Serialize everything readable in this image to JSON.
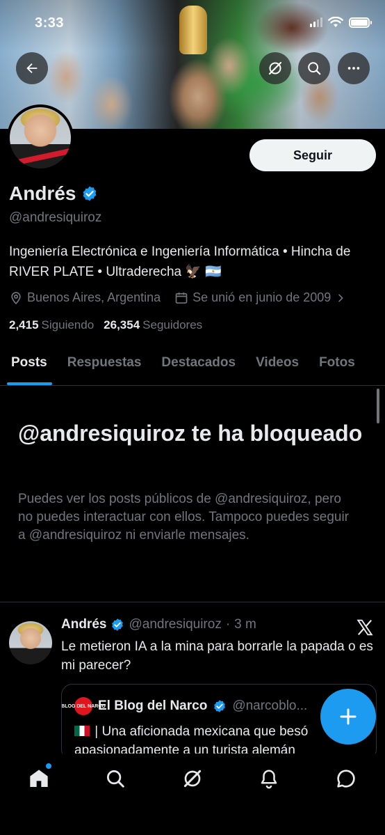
{
  "status_bar": {
    "time": "3:33"
  },
  "profile": {
    "name": "Andrés",
    "handle": "@andresiquiroz",
    "follow_label": "Seguir",
    "bio": "Ingeniería Electrónica e Ingeniería Informática • Hincha de RIVER PLATE • Ultraderecha 🦅 🇦🇷",
    "location": "Buenos Aires, Argentina",
    "joined": "Se unió en junio de 2009",
    "following_count": "2,415",
    "following_label": "Siguiendo",
    "followers_count": "26,354",
    "followers_label": "Seguidores"
  },
  "tabs": [
    {
      "label": "Posts",
      "active": true
    },
    {
      "label": "Respuestas"
    },
    {
      "label": "Destacados"
    },
    {
      "label": "Videos"
    },
    {
      "label": "Fotos"
    }
  ],
  "blocked": {
    "title": "@andresiquiroz te ha bloqueado",
    "text": "Puedes ver los posts públicos de @andresiquiroz, pero no puedes interactuar con ellos. Tampoco puedes seguir a @andresiquiroz ni enviarle mensajes."
  },
  "post": {
    "name": "Andrés",
    "handle": "@andresiquiroz",
    "separator": "·",
    "time": "3 m",
    "text": "Le metieron IA a la mina para borrarle la papada o es mi parecer?",
    "quote": {
      "logo_text": "BLOG DEL NARCO",
      "name": "El Blog del Narco",
      "handle": "@narcoblo...",
      "text": "| Una aficionada mexicana que besó apasionadamente a un turista alemán"
    }
  },
  "colors": {
    "accent": "#1d9bf0",
    "background": "#000000",
    "secondary_text": "#71767b"
  },
  "icons": {
    "back": "arrow-left-icon",
    "grok": "grok-icon",
    "search": "search-icon",
    "more": "more-icon",
    "compose": "plus-icon",
    "nav": [
      "home-icon",
      "search-icon",
      "grok-icon",
      "notifications-icon",
      "messages-icon"
    ]
  }
}
